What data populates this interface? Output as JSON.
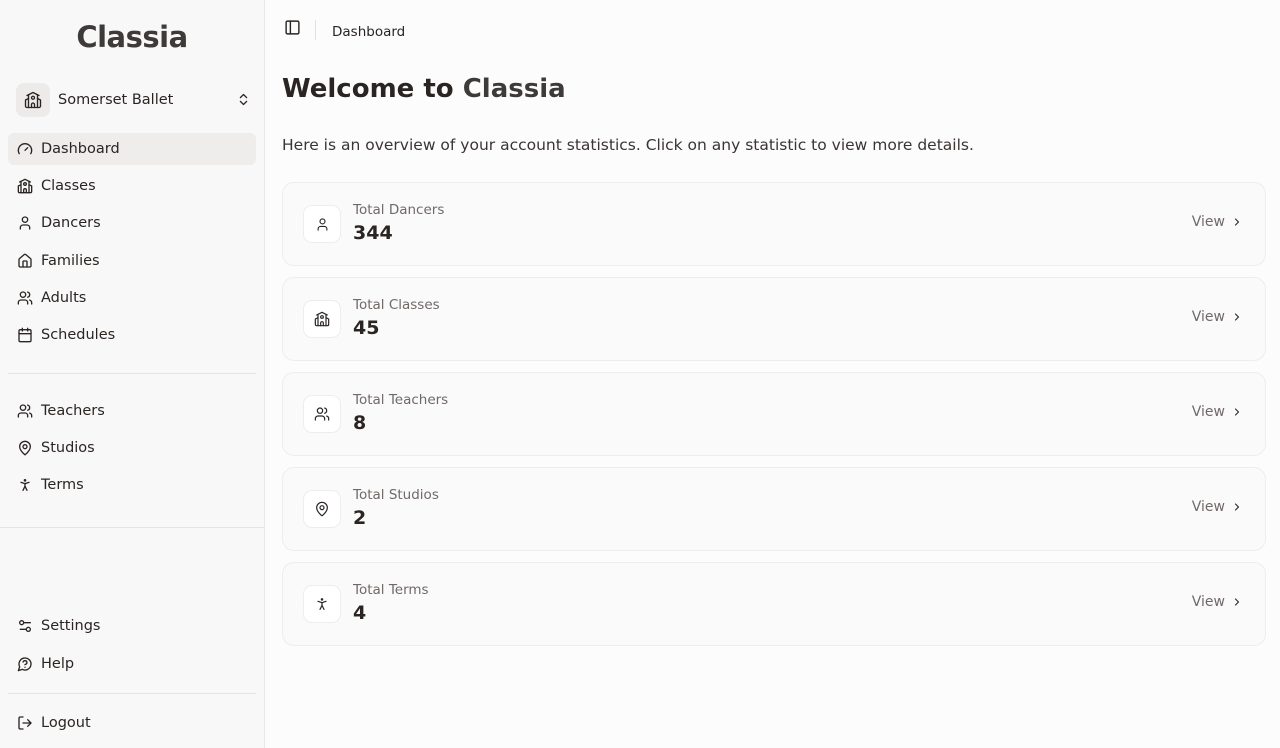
{
  "app": {
    "logo": "Classia"
  },
  "org": {
    "name": "Somerset Ballet",
    "icon": "school-building-icon"
  },
  "sidebar": {
    "primary": [
      {
        "label": "Dashboard",
        "icon": "gauge-icon",
        "active": true
      },
      {
        "label": "Classes",
        "icon": "school-building-icon"
      },
      {
        "label": "Dancers",
        "icon": "user-icon"
      },
      {
        "label": "Families",
        "icon": "home-icon"
      },
      {
        "label": "Adults",
        "icon": "users-icon"
      },
      {
        "label": "Schedules",
        "icon": "calendar-icon"
      }
    ],
    "secondary": [
      {
        "label": "Teachers",
        "icon": "users-icon"
      },
      {
        "label": "Studios",
        "icon": "map-pin-icon"
      },
      {
        "label": "Terms",
        "icon": "person-standing-icon"
      }
    ],
    "bottom": [
      {
        "label": "Settings",
        "icon": "settings-sliders-icon"
      },
      {
        "label": "Help",
        "icon": "help-circle-icon"
      }
    ],
    "logout": {
      "label": "Logout",
      "icon": "logout-icon"
    }
  },
  "header": {
    "breadcrumb": "Dashboard"
  },
  "main": {
    "title_prefix": "Welcome to ",
    "title_brand": "Classia",
    "subtitle": "Here is an overview of your account statistics. Click on any statistic to view more details.",
    "stats": [
      {
        "label": "Total Dancers",
        "value": "344",
        "icon": "user-icon",
        "action": "View"
      },
      {
        "label": "Total Classes",
        "value": "45",
        "icon": "school-building-icon",
        "action": "View"
      },
      {
        "label": "Total Teachers",
        "value": "8",
        "icon": "users-icon",
        "action": "View"
      },
      {
        "label": "Total Studios",
        "value": "2",
        "icon": "map-pin-icon",
        "action": "View"
      },
      {
        "label": "Total Terms",
        "value": "4",
        "icon": "person-standing-icon",
        "action": "View"
      }
    ]
  },
  "colors": {
    "text": "#2a2523",
    "muted": "#6f6967",
    "sidebar_bg": "#f9f8f8",
    "active_bg": "#efedec"
  }
}
